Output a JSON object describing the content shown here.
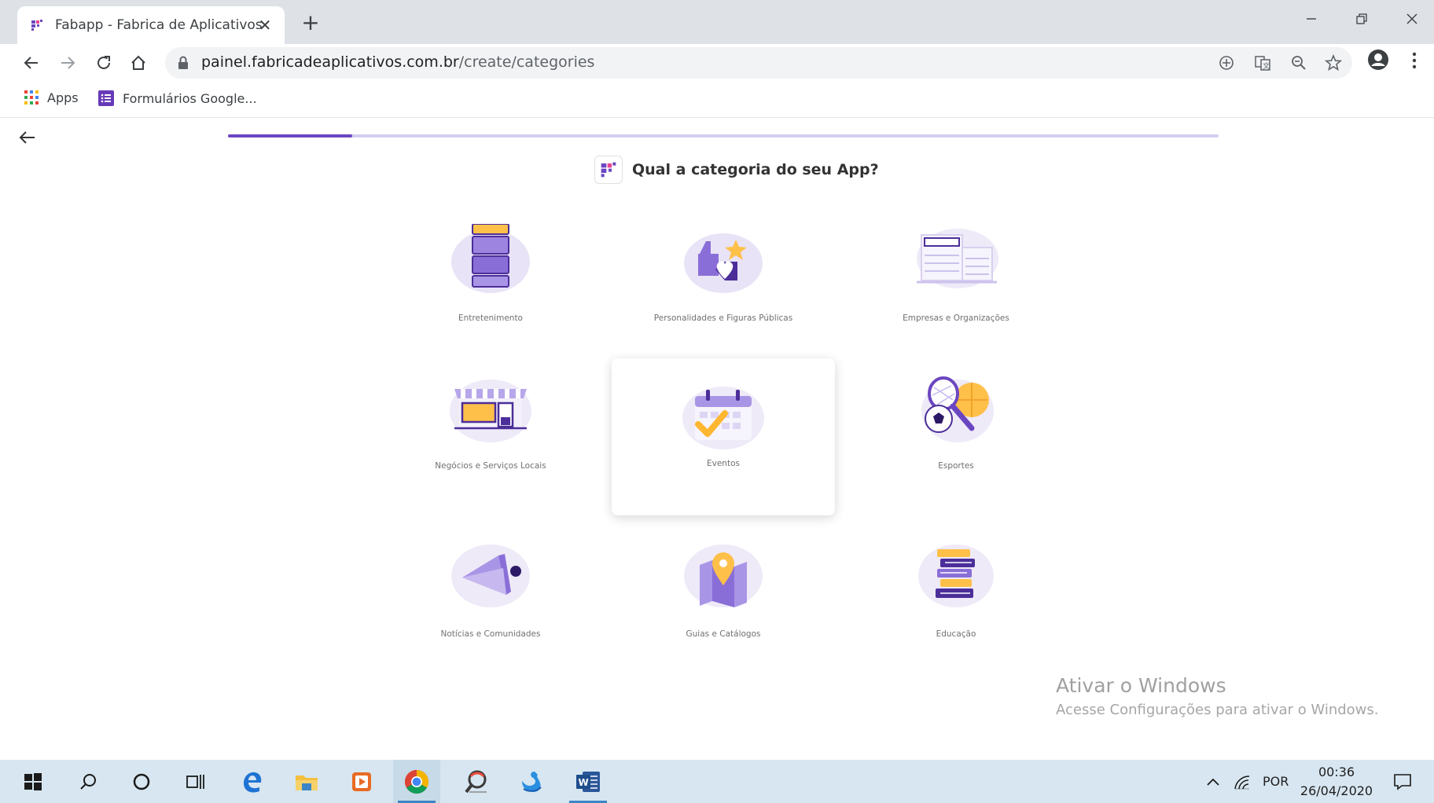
{
  "browser": {
    "tab_title": "Fabapp - Fabrica de Aplicativos",
    "tab_close": "✕",
    "new_tab": "+",
    "url_host": "painel.fabricadeaplicativos.com.br",
    "url_path": "/create/categories",
    "bookmarks": [
      {
        "label": "Apps",
        "icon": "apps-grid-icon"
      },
      {
        "label": "Formulários Google...",
        "icon": "google-forms-icon"
      }
    ]
  },
  "page": {
    "question": "Qual a categoria do seu App?",
    "progress_fraction": 0.125,
    "accent_color": "#6b46c1",
    "categories": [
      {
        "label": "Entretenimento",
        "icon": "film-strip-icon",
        "selected": false
      },
      {
        "label": "Personalidades e Figuras Públicas",
        "icon": "like-star-icon",
        "selected": false
      },
      {
        "label": "Empresas e Organizações",
        "icon": "office-building-icon",
        "selected": false
      },
      {
        "label": "Negócios e Serviços Locais",
        "icon": "storefront-icon",
        "selected": false
      },
      {
        "label": "Eventos",
        "icon": "calendar-check-icon",
        "selected": true
      },
      {
        "label": "Esportes",
        "icon": "sports-balls-icon",
        "selected": false
      },
      {
        "label": "Notícias e Comunidades",
        "icon": "megaphone-icon",
        "selected": false
      },
      {
        "label": "Guias e Catálogos",
        "icon": "map-pin-icon",
        "selected": false
      },
      {
        "label": "Educação",
        "icon": "books-icon",
        "selected": false
      }
    ]
  },
  "watermark": {
    "title": "Ativar o Windows",
    "subtitle": "Acesse Configurações para ativar o Windows."
  },
  "taskbar": {
    "language": "POR",
    "time": "00:36",
    "date": "26/04/2020"
  }
}
